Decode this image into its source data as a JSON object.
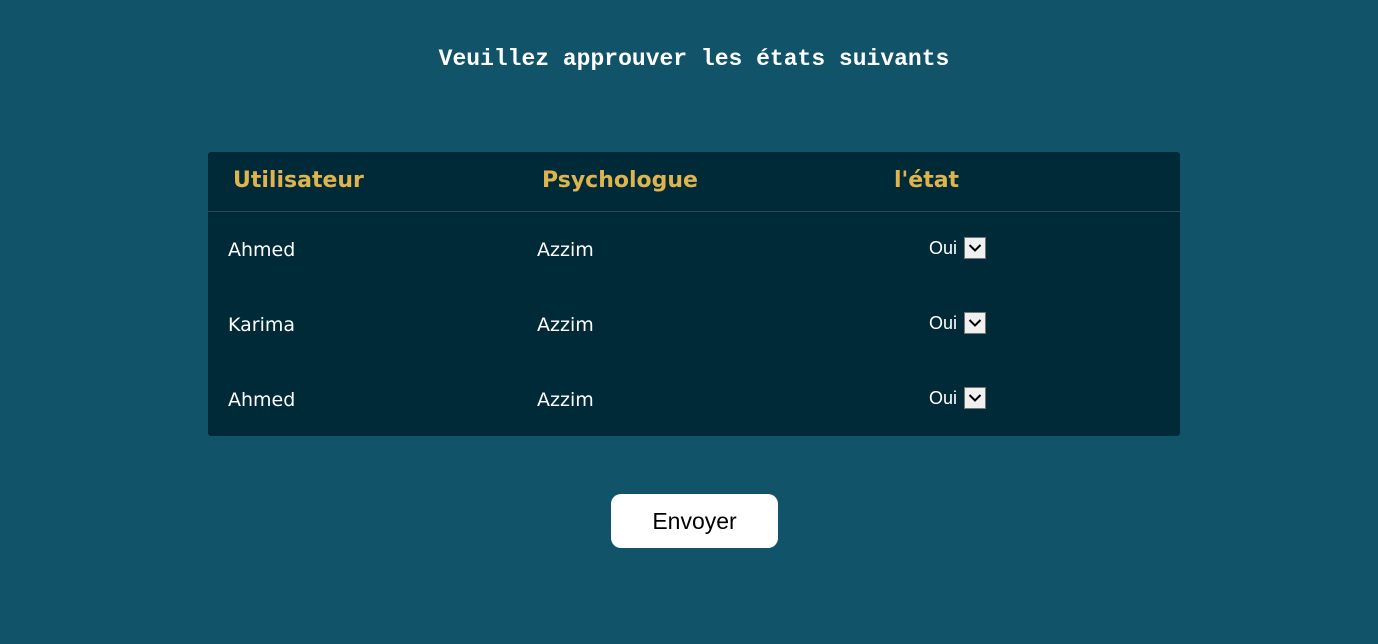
{
  "page": {
    "title": "Veuillez approuver les états suivants"
  },
  "table": {
    "headers": {
      "user": "Utilisateur",
      "psychologist": "Psychologue",
      "state": "l'état"
    },
    "rows": [
      {
        "user": "Ahmed",
        "psychologist": "Azzim",
        "state": "Oui"
      },
      {
        "user": "Karima",
        "psychologist": "Azzim",
        "state": "Oui"
      },
      {
        "user": "Ahmed",
        "psychologist": "Azzim",
        "state": "Oui"
      }
    ]
  },
  "actions": {
    "submit_label": "Envoyer"
  },
  "icons": {
    "dropdown": "chevron-down-icon"
  },
  "colors": {
    "background": "#11546a",
    "table_background": "#012a39",
    "header_text": "#e0b44d",
    "button_background": "#ffffff"
  }
}
